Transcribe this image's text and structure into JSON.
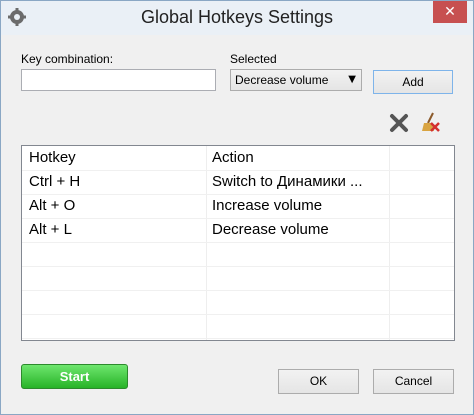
{
  "window": {
    "title": "Global Hotkeys Settings",
    "close_glyph": "✕",
    "app_icon": "app-gear-icon"
  },
  "form": {
    "key_label": "Key combination:",
    "key_value": "",
    "selected_label": "Selected",
    "selected_value": "Decrease volume",
    "add_label": "Add"
  },
  "toolbar": {
    "delete_icon": "delete-x-icon",
    "clear_icon": "broom-clear-icon"
  },
  "table": {
    "headers": [
      "Hotkey",
      "Action"
    ],
    "rows": [
      {
        "hotkey": "Ctrl + H",
        "action": "Switch to Динамики ..."
      },
      {
        "hotkey": "Alt + O",
        "action": "Increase volume"
      },
      {
        "hotkey": "Alt + L",
        "action": "Decrease volume"
      }
    ]
  },
  "footer": {
    "start_label": "Start",
    "ok_label": "OK",
    "cancel_label": "Cancel"
  },
  "colors": {
    "close": "#c75050",
    "start": "#27b327"
  }
}
